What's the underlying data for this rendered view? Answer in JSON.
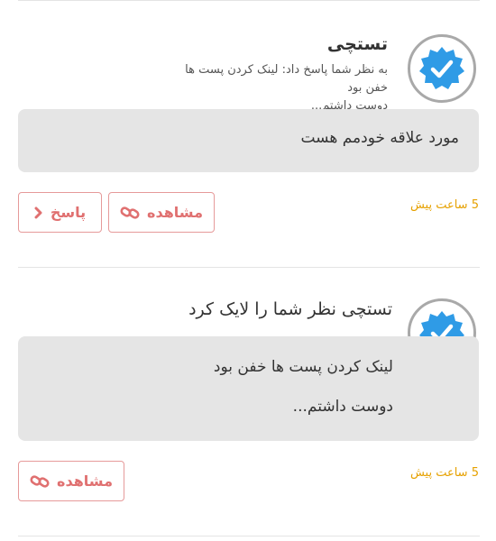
{
  "notifications": [
    {
      "name": "تستچی",
      "subtext_line1": "به نظر شما پاسخ داد: لینک کردن پست ها خفن بود",
      "subtext_line2": "دوست داشتم...",
      "message": "مورد علاقه خودمم هست",
      "time": "5 ساعت پیش",
      "view_label": "مشاهده",
      "reply_label": "پاسخ"
    },
    {
      "headline": "تستچی نظر شما را لایک کرد",
      "message_line1": "لینک کردن پست ها خفن بود",
      "message_line2": "دوست داشتم...",
      "time": "5 ساعت پیش",
      "view_label": "مشاهده"
    }
  ],
  "colors": {
    "accent": "#e07070",
    "time": "#e6a100",
    "badge": "#2f9be6",
    "bubble": "#e5e5e5"
  },
  "icons": [
    "verified-badge-icon",
    "link-icon",
    "chevron-right-icon"
  ]
}
